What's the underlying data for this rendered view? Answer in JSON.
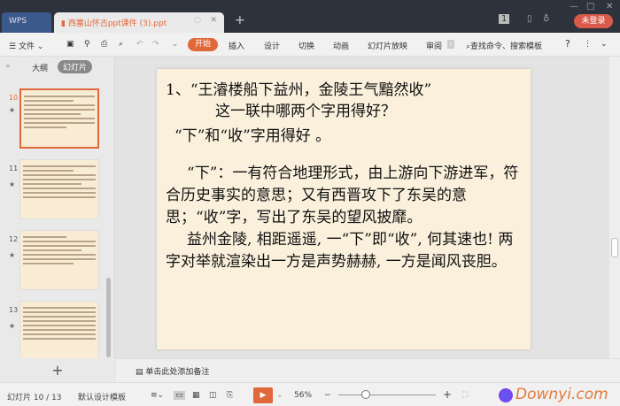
{
  "titlebar": {
    "wps_tab": "WPS",
    "doc_tab": "西塞山怀古ppt课件 (3).ppt",
    "new_tab": "+",
    "badge": "1",
    "login": "未登录"
  },
  "toolbar": {
    "file": "文件",
    "tabs": [
      "开始",
      "插入",
      "设计",
      "切换",
      "动画",
      "幻灯片放映",
      "审阅"
    ],
    "search": "查找命令、搜索模板",
    "help": "?"
  },
  "left_panel": {
    "outline_tab": "大纲",
    "slides_tab": "幻灯片",
    "thumbnails": [
      {
        "num": "10"
      },
      {
        "num": "11"
      },
      {
        "num": "12"
      },
      {
        "num": "13"
      }
    ],
    "add": "+"
  },
  "slide": {
    "line1": "1、“王濬楼船下益州，金陵王气黯然收”",
    "line2": "这一联中哪两个字用得好？",
    "line3": "“下”和“收”字用得好 。",
    "para1": "“下”：一有符合地理形式，由上游向下游进军，符合历史事实的意思；又有西晋攻下了东吴的意思；“收”字，写出了东吴的望风披靡。",
    "para2": "益州金陵, 相距遥遥, 一“下”即“收”, 何其速也! 两字对举就渲染出一方是声势赫赫, 一方是闻风丧胆。"
  },
  "notes": {
    "placeholder": "单击此处添加备注"
  },
  "status": {
    "slide_count": "幻灯片 10 / 13",
    "template": "默认设计模板",
    "zoom": "56%",
    "zoom_minus": "−",
    "zoom_plus": "+",
    "watermark": "Downyi.com"
  }
}
